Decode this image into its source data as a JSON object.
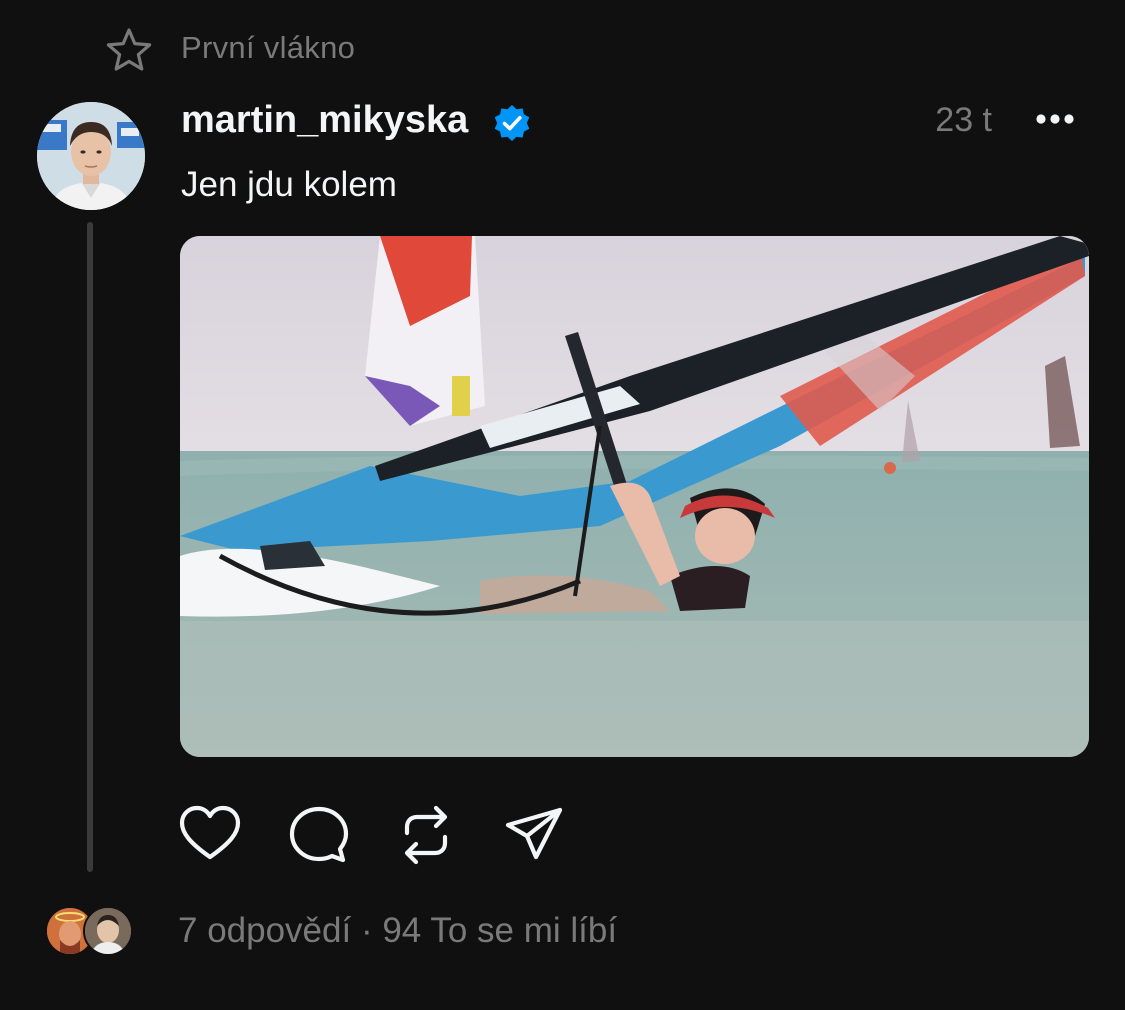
{
  "thread": {
    "label": "První vlákno"
  },
  "post": {
    "username": "martin_mikyska",
    "verified": true,
    "timestamp": "23 t",
    "text": "Jen jdu kolem",
    "media": {
      "type": "video",
      "muted": true
    }
  },
  "actions": [
    "heart-icon",
    "comment-icon",
    "repost-icon",
    "share-icon"
  ],
  "footer": {
    "replies": "7 odpovědí",
    "separator": "·",
    "likes": "94 To se mi líbí"
  },
  "colors": {
    "background": "#101010",
    "text_primary": "#f3f5f7",
    "text_secondary": "#7a7a7a",
    "verified_blue": "#0095f6"
  }
}
